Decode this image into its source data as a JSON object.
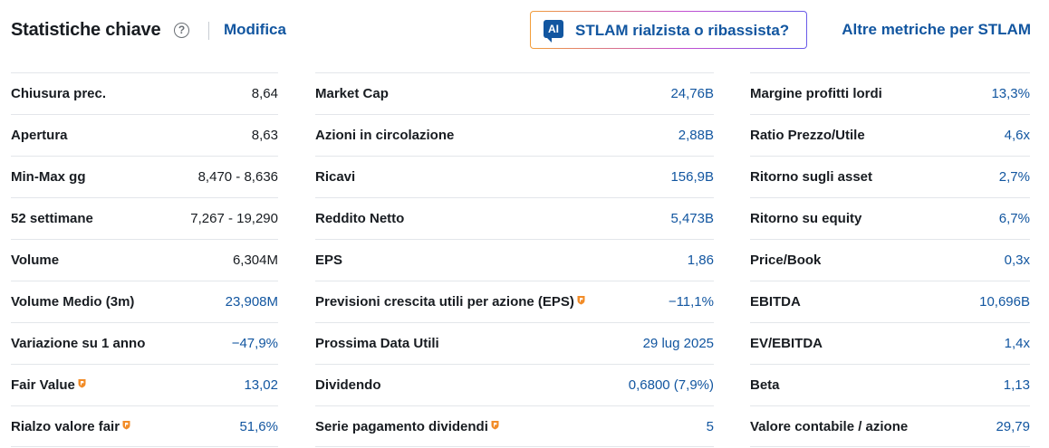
{
  "header": {
    "title": "Statistiche chiave",
    "help_symbol": "?",
    "edit_label": "Modifica",
    "ai_badge": "AI",
    "ai_label": "STLAM rialzista o ribassista?",
    "more_label": "Altre metriche per STLAM"
  },
  "colors": {
    "link": "#1256a0",
    "text": "#181c21",
    "pro_icon": "#f28c28"
  },
  "columns": [
    [
      {
        "label": "Chiusura prec.",
        "value": "8,64",
        "link": false,
        "pro": false
      },
      {
        "label": "Apertura",
        "value": "8,63",
        "link": false,
        "pro": false
      },
      {
        "label": "Min-Max gg",
        "value": "8,470 - 8,636",
        "link": false,
        "pro": false
      },
      {
        "label": "52 settimane",
        "value": "7,267 - 19,290",
        "link": false,
        "pro": false
      },
      {
        "label": "Volume",
        "value": "6,304M",
        "link": false,
        "pro": false
      },
      {
        "label": "Volume Medio (3m)",
        "value": "23,908M",
        "link": true,
        "pro": false
      },
      {
        "label": "Variazione su 1 anno",
        "value": "−47,9%",
        "link": true,
        "pro": false
      },
      {
        "label": "Fair Value",
        "value": "13,02",
        "link": true,
        "pro": true
      },
      {
        "label": "Rialzo valore fair",
        "value": "51,6%",
        "link": true,
        "pro": true
      }
    ],
    [
      {
        "label": "Market Cap",
        "value": "24,76B",
        "link": true,
        "pro": false
      },
      {
        "label": "Azioni in circolazione",
        "value": "2,88B",
        "link": true,
        "pro": false
      },
      {
        "label": "Ricavi",
        "value": "156,9B",
        "link": true,
        "pro": false
      },
      {
        "label": "Reddito Netto",
        "value": "5,473B",
        "link": true,
        "pro": false
      },
      {
        "label": "EPS",
        "value": "1,86",
        "link": true,
        "pro": false
      },
      {
        "label": "Previsioni crescita utili per azione (EPS)",
        "value": "−11,1%",
        "link": true,
        "pro": true
      },
      {
        "label": "Prossima Data Utili",
        "value": "29 lug 2025",
        "link": true,
        "pro": false
      },
      {
        "label": "Dividendo",
        "value": "0,6800 (7,9%)",
        "link": true,
        "pro": false
      },
      {
        "label": "Serie pagamento dividendi",
        "value": "5",
        "link": true,
        "pro": true
      }
    ],
    [
      {
        "label": "Margine profitti lordi",
        "value": "13,3%",
        "link": true,
        "pro": false
      },
      {
        "label": "Ratio Prezzo/Utile",
        "value": "4,6x",
        "link": true,
        "pro": false
      },
      {
        "label": "Ritorno sugli asset",
        "value": "2,7%",
        "link": true,
        "pro": false
      },
      {
        "label": "Ritorno su equity",
        "value": "6,7%",
        "link": true,
        "pro": false
      },
      {
        "label": "Price/Book",
        "value": "0,3x",
        "link": true,
        "pro": false
      },
      {
        "label": "EBITDA",
        "value": "10,696B",
        "link": true,
        "pro": false
      },
      {
        "label": "EV/EBITDA",
        "value": "1,4x",
        "link": true,
        "pro": false
      },
      {
        "label": "Beta",
        "value": "1,13",
        "link": true,
        "pro": false
      },
      {
        "label": "Valore contabile / azione",
        "value": "29,79",
        "link": true,
        "pro": false
      }
    ]
  ]
}
